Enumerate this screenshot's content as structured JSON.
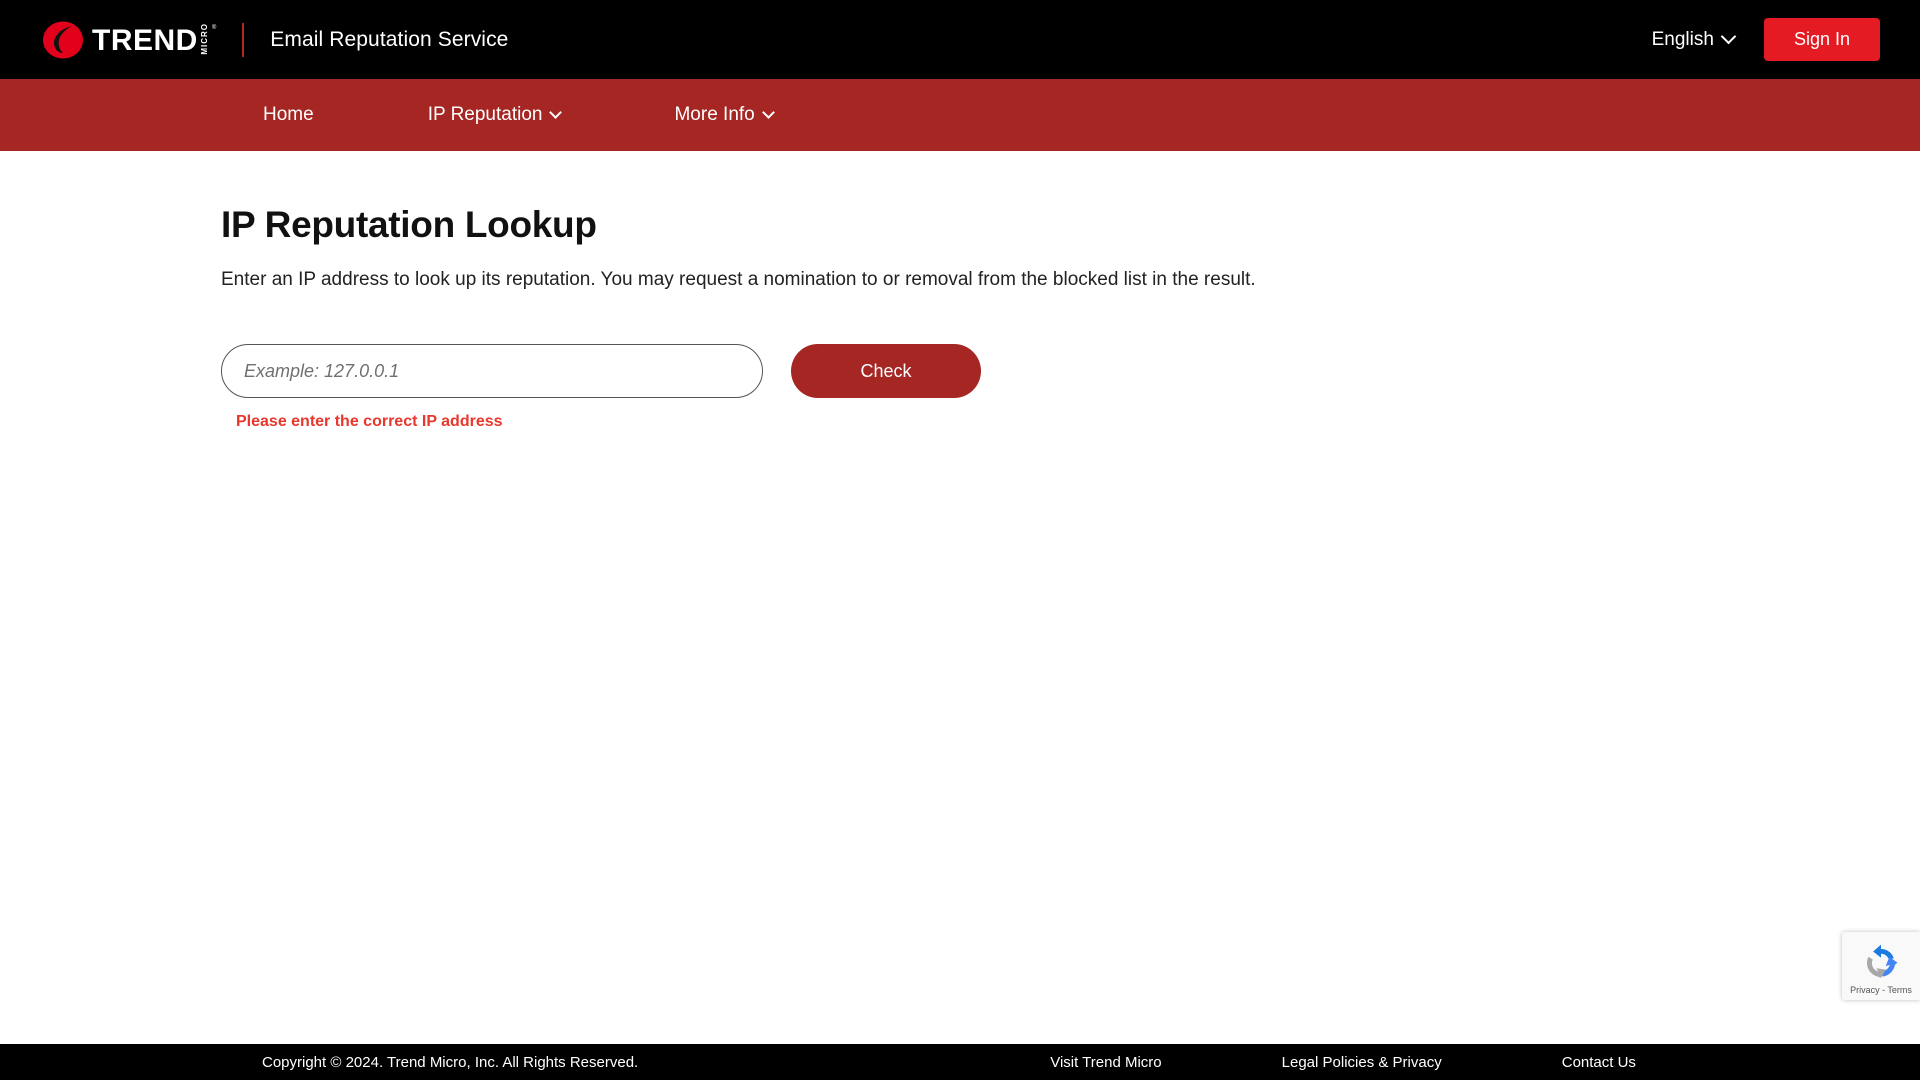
{
  "header": {
    "logo": {
      "mark": "trend-micro-logo-icon",
      "wordmark": "TREND",
      "sub": "MICRO",
      "tm": "®"
    },
    "brand_title": "Email Reputation Service",
    "language": {
      "label": "English",
      "caret": "chevron-down-icon"
    },
    "sign_in_label": "Sign In",
    "colors": {
      "background": "#000000",
      "sign_in_red": "#e51b24",
      "divider_red": "#b02a23"
    }
  },
  "nav": {
    "background": "#a52622",
    "items": [
      {
        "label": "Home",
        "has_caret": false
      },
      {
        "label": "IP Reputation",
        "has_caret": true
      },
      {
        "label": "More Info",
        "has_caret": true
      }
    ]
  },
  "main": {
    "title": "IP Reputation Lookup",
    "description": "Enter an IP address to look up its reputation. You may request a nomination to or removal from the blocked list in the result.",
    "ip_field": {
      "placeholder": "Example: 127.0.0.1",
      "value": ""
    },
    "check_label": "Check",
    "error_message": "Please enter the correct IP address",
    "error_color": "#e8372c",
    "check_button_color": "#a52622"
  },
  "recaptcha": {
    "icon": "recaptcha-icon",
    "text": "Privacy - Terms"
  },
  "footer": {
    "copyright": "Copyright © 2024. Trend Micro, Inc. All Rights Reserved.",
    "links": [
      {
        "label": "Visit Trend Micro"
      },
      {
        "label": "Legal Policies & Privacy"
      },
      {
        "label": "Contact Us"
      }
    ],
    "background": "#000000"
  }
}
